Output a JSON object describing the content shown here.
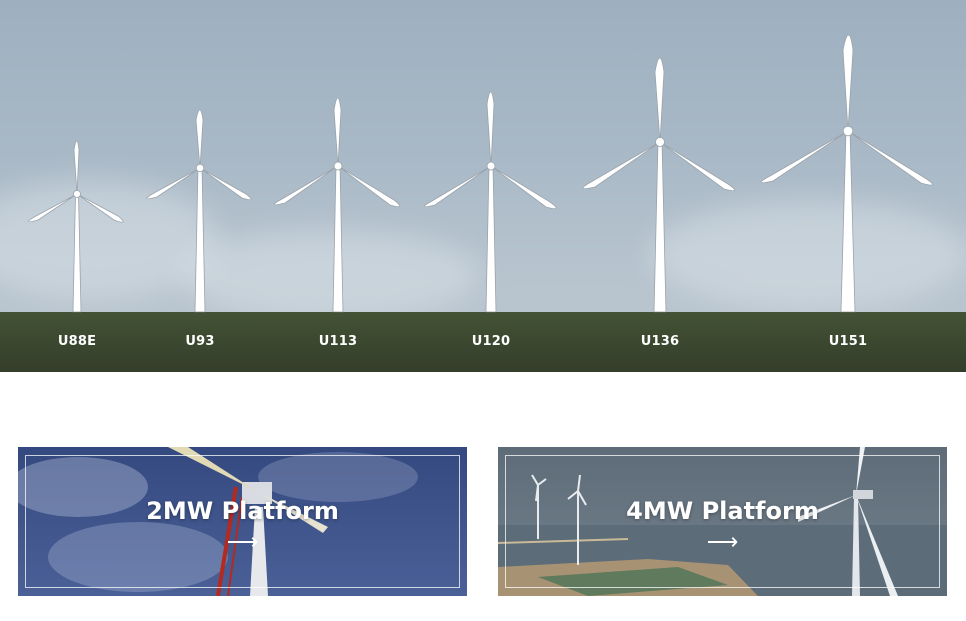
{
  "hero": {
    "turbines": [
      {
        "label": "U88E"
      },
      {
        "label": "U93"
      },
      {
        "label": "U113"
      },
      {
        "label": "U120"
      },
      {
        "label": "U136"
      },
      {
        "label": "U151"
      }
    ]
  },
  "cards": [
    {
      "title": "2MW Platform",
      "arrow": "⟶",
      "bg_color": "#3b4f86"
    },
    {
      "title": "4MW Platform",
      "arrow": "⟶",
      "bg_color": "#5c6a78"
    }
  ],
  "colors": {
    "sky": "#a8b8c6",
    "label_band": "#5a5a5a",
    "turbine_fill": "#ffffff"
  }
}
